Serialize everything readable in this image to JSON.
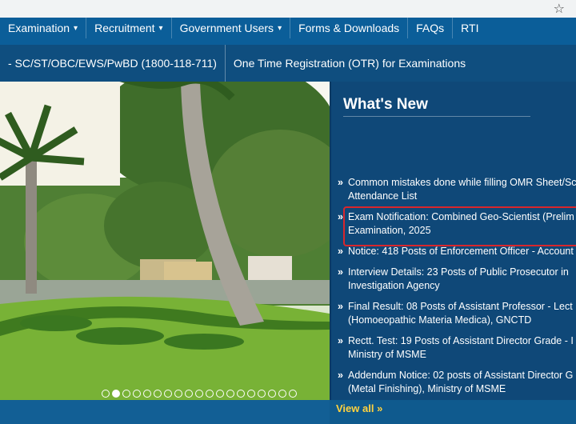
{
  "browser": {
    "star_icon": "star-icon"
  },
  "nav": {
    "items": [
      {
        "label": "Examination",
        "has_caret": true
      },
      {
        "label": "Recruitment",
        "has_caret": true
      },
      {
        "label": "Government Users",
        "has_caret": true
      },
      {
        "label": "Forms & Downloads",
        "has_caret": false
      },
      {
        "label": "FAQs",
        "has_caret": false
      },
      {
        "label": "RTI",
        "has_caret": false
      }
    ],
    "caret": "▾"
  },
  "subnav": {
    "items": [
      {
        "label": "- SC/ST/OBC/EWS/PwBD (1800-118-711)"
      },
      {
        "label": "One Time Registration (OTR) for Examinations"
      }
    ]
  },
  "whats_new": {
    "title": "What's New",
    "bullet": "»",
    "items": [
      {
        "line1": "Common mistakes done while filling OMR Sheet/Sc",
        "line2": "Attendance List"
      },
      {
        "line1": "Exam Notification: Combined Geo-Scientist (Prelim",
        "line2": "Examination, 2025"
      },
      {
        "line1": "Notice: 418 Posts of Enforcement Officer - Account",
        "line2": ""
      },
      {
        "line1": "Interview Details: 23 Posts of Public Prosecutor in",
        "line2": "Investigation Agency"
      },
      {
        "line1": "Final Result: 08 Posts of Assistant Professor - Lect",
        "line2": "(Homoeopathic Materia Medica), GNCTD"
      },
      {
        "line1": "Rectt. Test: 19 Posts of Assistant Director Grade - I",
        "line2": "Ministry of MSME"
      },
      {
        "line1": "Addendum Notice: 02 posts of Assistant Director G",
        "line2": "(Metal Finishing), Ministry of MSME"
      }
    ],
    "view_all": "View all »"
  },
  "slider": {
    "dot_count": 19,
    "active_index": 1
  },
  "colors": {
    "nav": "#0b5e99",
    "subnav": "#0f4e7f",
    "news_bg": "#0f4878",
    "highlight": "#d9262c",
    "view_all": "#ffd23f"
  }
}
